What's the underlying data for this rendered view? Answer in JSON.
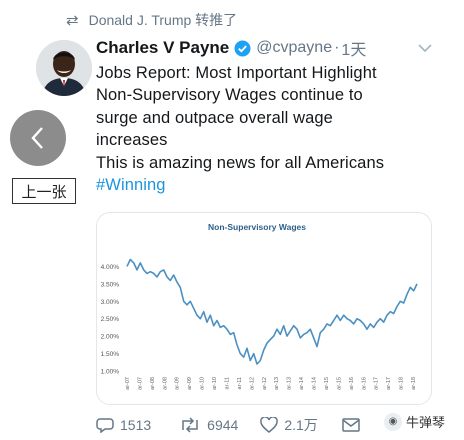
{
  "retweet": {
    "icon": "retweet-icon",
    "text": "Donald J. Trump 转推了"
  },
  "tweet": {
    "display_name": "Charles V Payne",
    "handle": "@cvpayne",
    "dot": "·",
    "timestamp": "1天",
    "lines": [
      "Jobs Report:  Most Important Highlight",
      "Non-Supervisory Wages continue to",
      "surge and outpace overall wage",
      "increases",
      "This is amazing news for all Americans"
    ],
    "hashtag": "#Winning"
  },
  "nav": {
    "prev_label": "上一张"
  },
  "actions": {
    "reply_count": "1513",
    "retweet_count": "6944",
    "like_count": "2.1万"
  },
  "watermark": {
    "text": "牛弹琴"
  },
  "colors": {
    "line": "#4a90c2",
    "link": "#1b95e0",
    "muted": "#657786",
    "title": "#2e5f8a"
  },
  "chart_data": {
    "type": "line",
    "title": "Non-Supervisory Wages",
    "xlabel": "",
    "ylabel": "",
    "ylim": [
      1.0,
      4.5
    ],
    "yticks": [
      "1.00%",
      "1.50%",
      "2.00%",
      "2.50%",
      "3.00%",
      "3.50%",
      "4.00%"
    ],
    "ytick_values": [
      1.0,
      1.5,
      2.0,
      2.5,
      3.0,
      3.5,
      4.0
    ],
    "xticks": [
      "ar-07",
      "ar-07",
      "ar-08",
      "ar-08",
      "ar-09",
      "ar-09",
      "ar-10",
      "ar-10",
      "ar-11",
      "ar-11",
      "ar-12",
      "ar-12",
      "ar-13",
      "ar-13",
      "ar-14",
      "ar-14",
      "ar-15",
      "ar-15",
      "ar-16",
      "ar-16",
      "ar-17",
      "ar-17",
      "ar-18",
      "ar-18"
    ],
    "grid": false,
    "series": [
      {
        "values": [
          4.0,
          4.2,
          4.1,
          3.9,
          4.1,
          3.9,
          3.8,
          3.85,
          3.8,
          3.7,
          3.85,
          3.9,
          3.7,
          3.6,
          3.75,
          3.55,
          3.4,
          3.0,
          2.9,
          3.0,
          2.8,
          2.6,
          2.5,
          2.7,
          2.4,
          2.6,
          2.3,
          2.45,
          2.25,
          2.3,
          2.2,
          2.05,
          2.1,
          1.75,
          1.5,
          1.4,
          1.65,
          1.3,
          1.5,
          1.2,
          1.3,
          1.6,
          1.8,
          1.9,
          2.0,
          2.2,
          2.05,
          2.3,
          2.0,
          2.15,
          2.3,
          2.2,
          1.95,
          2.05,
          2.1,
          2.2,
          1.95,
          1.7,
          2.1,
          2.2,
          2.35,
          2.3,
          2.45,
          2.6,
          2.45,
          2.6,
          2.5,
          2.45,
          2.35,
          2.5,
          2.45,
          2.35,
          2.2,
          2.35,
          2.25,
          2.4,
          2.5,
          2.4,
          2.6,
          2.7,
          2.65,
          2.85,
          3.0,
          2.95,
          3.2,
          3.4,
          3.3,
          3.5
        ]
      }
    ]
  }
}
